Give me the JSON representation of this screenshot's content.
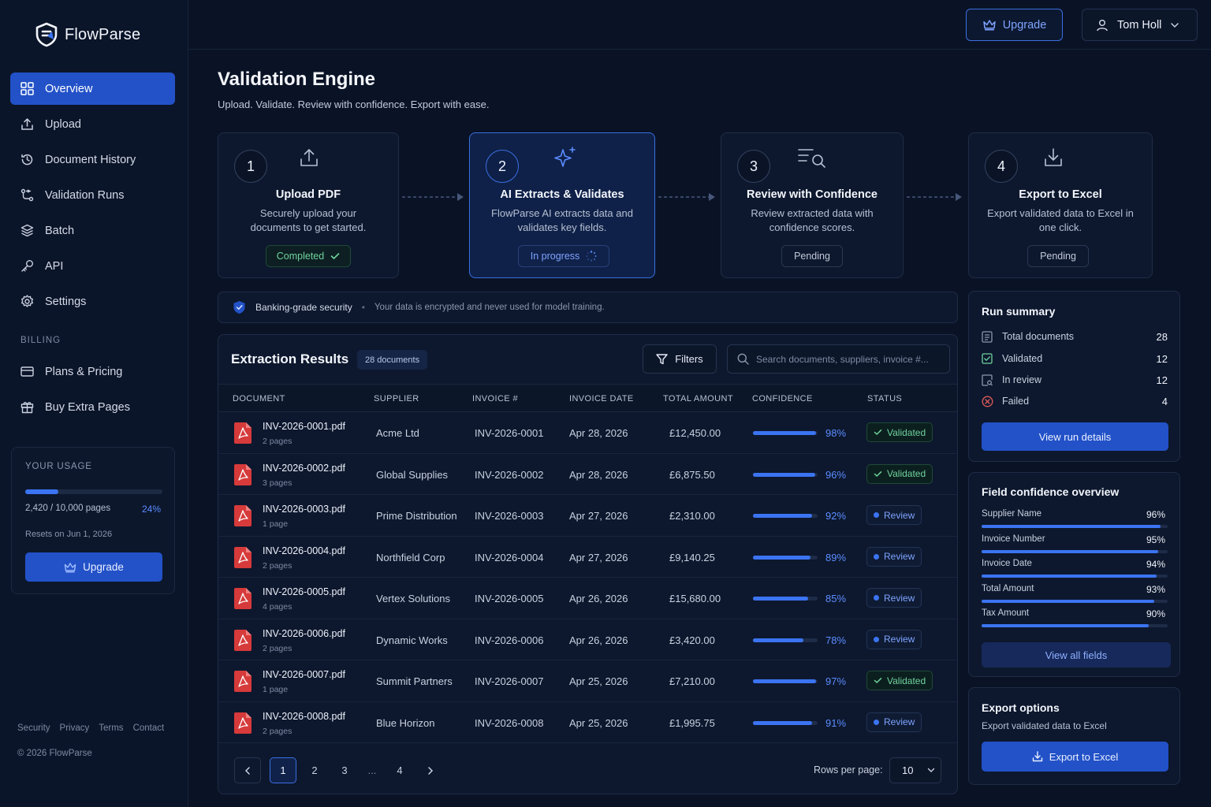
{
  "brand": {
    "name": "FlowParse"
  },
  "sidebar": {
    "items": [
      {
        "label": "Overview",
        "icon": "grid-icon",
        "active": true
      },
      {
        "label": "Upload",
        "icon": "upload-icon"
      },
      {
        "label": "Document History",
        "icon": "history-icon"
      },
      {
        "label": "Validation Runs",
        "icon": "workflow-icon"
      },
      {
        "label": "Batch",
        "icon": "layers-icon"
      },
      {
        "label": "API",
        "icon": "key-icon"
      },
      {
        "label": "Settings",
        "icon": "gear-icon"
      }
    ],
    "billing_label": "BILLING",
    "billing_items": [
      {
        "label": "Plans & Pricing",
        "icon": "card-icon"
      },
      {
        "label": "Buy Extra Pages",
        "icon": "gift-icon"
      }
    ],
    "usage": {
      "title": "YOUR USAGE",
      "pages": "2,420 / 10,000 pages",
      "percent_label": "24%",
      "fraction": 0.24,
      "resets": "Resets on Jun 1, 2026",
      "upgrade_label": "Upgrade"
    },
    "footer_links": [
      "Security",
      "Privacy",
      "Terms",
      "Contact"
    ],
    "copyright": "© 2026 FlowParse"
  },
  "topbar": {
    "upgrade_label": "Upgrade",
    "user_name": "Tom Holl"
  },
  "header": {
    "title": "Validation Engine",
    "subtitle": "Upload. Validate. Review with confidence. Export with ease."
  },
  "steps": [
    {
      "number": "1",
      "title": "Upload PDF",
      "desc": "Securely upload your documents to get started.",
      "status": "Completed"
    },
    {
      "number": "2",
      "title": "AI Extracts & Validates",
      "desc": "FlowParse AI extracts data and validates key fields.",
      "status": "In progress"
    },
    {
      "number": "3",
      "title": "Review with Confidence",
      "desc": "Review extracted data with confidence scores.",
      "status": "Pending"
    },
    {
      "number": "4",
      "title": "Export to Excel",
      "desc": "Export validated data to Excel in one click.",
      "status": "Pending"
    }
  ],
  "security": {
    "strong": "Banking-grade security",
    "separator": "•",
    "text": "Your data is encrypted and never used for model training."
  },
  "results": {
    "title": "Extraction Results",
    "count": "28 documents",
    "filters_label": "Filters",
    "search_placeholder": "Search documents, suppliers, invoice #...",
    "columns": [
      "DOCUMENT",
      "SUPPLIER",
      "INVOICE #",
      "INVOICE DATE",
      "TOTAL AMOUNT",
      "CONFIDENCE",
      "STATUS"
    ],
    "rows": [
      {
        "file": "INV-2026-0001.pdf",
        "pages": "2 pages",
        "supplier": "Acme Ltd",
        "invoice": "INV-2026-0001",
        "date": "Apr 28, 2026",
        "amount": "£12,450.00",
        "confidence": "98%",
        "conf_value": 0.98,
        "status": "Validated"
      },
      {
        "file": "INV-2026-0002.pdf",
        "pages": "3 pages",
        "supplier": "Global Supplies",
        "invoice": "INV-2026-0002",
        "date": "Apr 28, 2026",
        "amount": "£6,875.50",
        "confidence": "96%",
        "conf_value": 0.96,
        "status": "Validated"
      },
      {
        "file": "INV-2026-0003.pdf",
        "pages": "1 page",
        "supplier": "Prime Distribution",
        "invoice": "INV-2026-0003",
        "date": "Apr 27, 2026",
        "amount": "£2,310.00",
        "confidence": "92%",
        "conf_value": 0.92,
        "status": "Review"
      },
      {
        "file": "INV-2026-0004.pdf",
        "pages": "2 pages",
        "supplier": "Northfield Corp",
        "invoice": "INV-2026-0004",
        "date": "Apr 27, 2026",
        "amount": "£9,140.25",
        "confidence": "89%",
        "conf_value": 0.89,
        "status": "Review"
      },
      {
        "file": "INV-2026-0005.pdf",
        "pages": "4 pages",
        "supplier": "Vertex Solutions",
        "invoice": "INV-2026-0005",
        "date": "Apr 26, 2026",
        "amount": "£15,680.00",
        "confidence": "85%",
        "conf_value": 0.85,
        "status": "Review"
      },
      {
        "file": "INV-2026-0006.pdf",
        "pages": "2 pages",
        "supplier": "Dynamic Works",
        "invoice": "INV-2026-0006",
        "date": "Apr 26, 2026",
        "amount": "£3,420.00",
        "confidence": "78%",
        "conf_value": 0.78,
        "status": "Review"
      },
      {
        "file": "INV-2026-0007.pdf",
        "pages": "1 page",
        "supplier": "Summit Partners",
        "invoice": "INV-2026-0007",
        "date": "Apr 25, 2026",
        "amount": "£7,210.00",
        "confidence": "97%",
        "conf_value": 0.97,
        "status": "Validated"
      },
      {
        "file": "INV-2026-0008.pdf",
        "pages": "2 pages",
        "supplier": "Blue Horizon",
        "invoice": "INV-2026-0008",
        "date": "Apr 25, 2026",
        "amount": "£1,995.75",
        "confidence": "91%",
        "conf_value": 0.91,
        "status": "Review"
      }
    ],
    "pagination": {
      "pages": [
        "1",
        "2",
        "3",
        "...",
        "4"
      ],
      "current": "1",
      "rows_label": "Rows per page:",
      "rows_value": "10"
    }
  },
  "run_summary": {
    "title": "Run summary",
    "items": [
      {
        "label": "Total documents",
        "value": "28",
        "icon": "document-icon"
      },
      {
        "label": "Validated",
        "value": "12",
        "icon": "check-box-icon"
      },
      {
        "label": "In review",
        "value": "12",
        "icon": "review-doc-icon"
      },
      {
        "label": "Failed",
        "value": "4",
        "icon": "x-circle-icon"
      }
    ],
    "button_label": "View run details"
  },
  "field_confidence": {
    "title": "Field confidence overview",
    "items": [
      {
        "label": "Supplier Name",
        "pct": "96%",
        "value": 0.96
      },
      {
        "label": "Invoice Number",
        "pct": "95%",
        "value": 0.95
      },
      {
        "label": "Invoice Date",
        "pct": "94%",
        "value": 0.94
      },
      {
        "label": "Total Amount",
        "pct": "93%",
        "value": 0.93
      },
      {
        "label": "Tax Amount",
        "pct": "90%",
        "value": 0.9
      }
    ],
    "button_label": "View all fields"
  },
  "export": {
    "title": "Export options",
    "subtitle": "Export validated data to Excel",
    "button_label": "Export to Excel"
  },
  "colors": {
    "accent": "#2352c8",
    "link": "#5b8cff",
    "success": "#6fd39d",
    "background": "#0a1326"
  }
}
